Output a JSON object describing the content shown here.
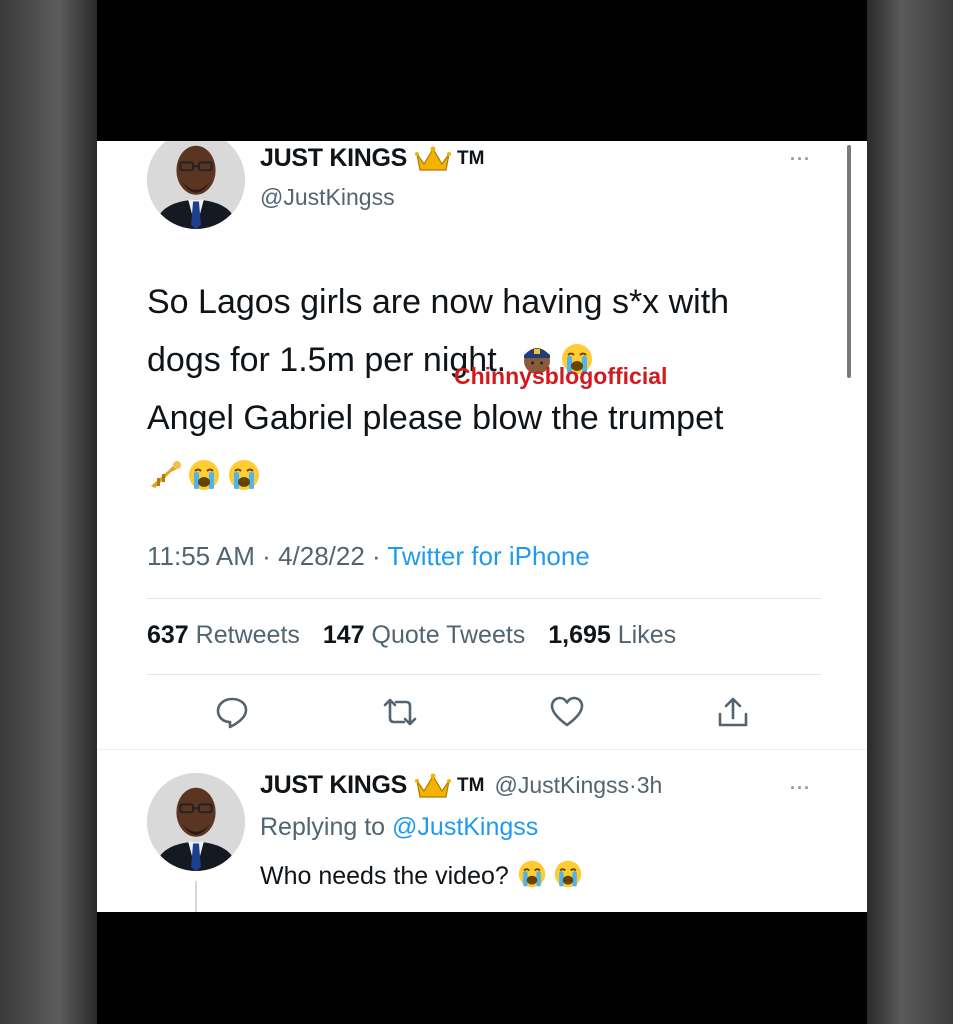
{
  "tweet": {
    "display_name": "JUST KINGS",
    "tm": "TM",
    "handle": "@JustKingss",
    "text_lines": [
      "So Lagos girls are now having s*x with",
      "dogs for 1.5m per night.",
      "Angel Gabriel please blow the trumpet"
    ],
    "time": "11:55 AM",
    "date": "4/28/22",
    "source": "Twitter for iPhone",
    "retweets_count": "637",
    "retweets_label": "Retweets",
    "quotes_count": "147",
    "quotes_label": "Quote Tweets",
    "likes_count": "1,695",
    "likes_label": "Likes"
  },
  "watermark": "Chinnysblogofficial",
  "reply": {
    "display_name": "JUST KINGS",
    "tm": "TM",
    "handle": "@JustKingss",
    "age": "3h",
    "replying_prefix": "Replying to",
    "replying_handle": "@JustKingss",
    "text": "Who needs the video?"
  },
  "icons": {
    "crown": "crown-icon",
    "more": "more-options-icon",
    "reply": "reply-icon",
    "retweet": "retweet-icon",
    "like": "heart-icon",
    "share": "share-icon",
    "emoji_police": "police-officer-emoji",
    "emoji_crying": "loudly-crying-face-emoji",
    "emoji_trumpet": "trumpet-emoji"
  },
  "colors": {
    "link": "#1d9bf0",
    "secondary_text": "#536471",
    "primary_text": "#0f1419",
    "watermark": "#d1191e"
  }
}
